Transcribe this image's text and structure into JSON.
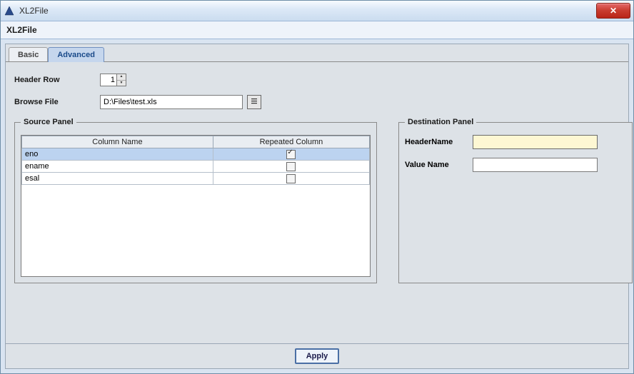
{
  "window": {
    "title": "XL2File",
    "close_symbol": "✕"
  },
  "subheader": {
    "title": "XL2File"
  },
  "tabs": {
    "basic": "Basic",
    "advanced": "Advanced",
    "active": "advanced"
  },
  "form": {
    "header_row_label": "Header Row",
    "header_row_value": "1",
    "browse_label": "Browse File",
    "browse_value": "D:\\Files\\test.xls"
  },
  "source_panel": {
    "legend": "Source Panel",
    "columns": {
      "name": "Column Name",
      "repeated": "Repeated Column"
    },
    "rows": [
      {
        "name": "eno",
        "repeated": true,
        "selected": true
      },
      {
        "name": "ename",
        "repeated": false,
        "selected": false
      },
      {
        "name": "esal",
        "repeated": false,
        "selected": false
      }
    ]
  },
  "dest_panel": {
    "legend": "Destination Panel",
    "header_name_label": "HeaderName",
    "header_name_value": "",
    "value_name_label": "Value Name",
    "value_name_value": ""
  },
  "buttons": {
    "apply": "Apply"
  }
}
